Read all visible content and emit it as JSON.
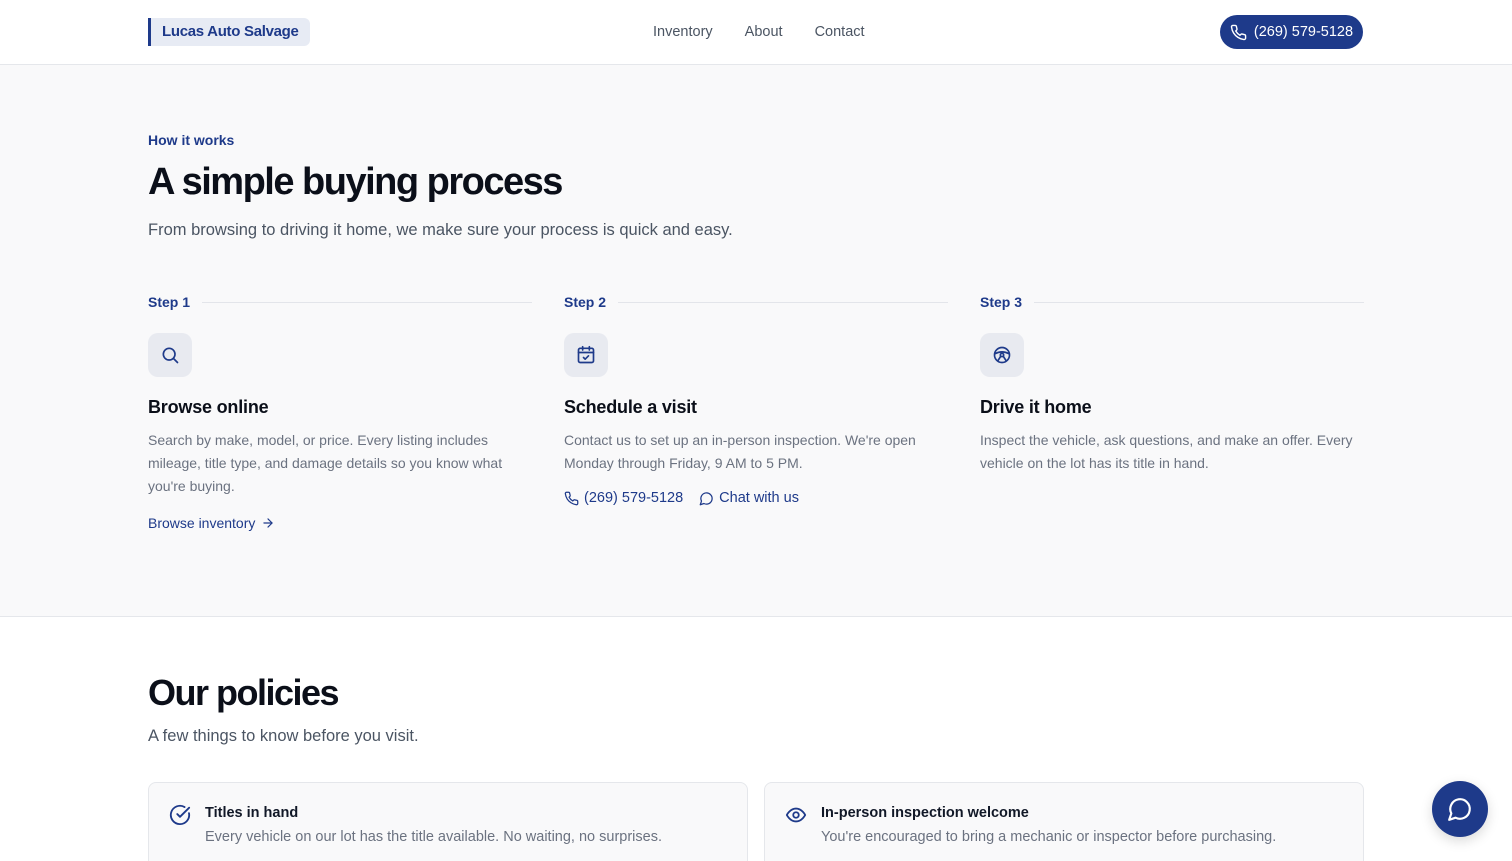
{
  "header": {
    "logo": "Lucas Auto Salvage",
    "nav": [
      "Inventory",
      "About",
      "Contact"
    ],
    "phone": "(269) 579-5128"
  },
  "how": {
    "eyebrow": "How it works",
    "title": "A simple buying process",
    "subtitle": "From browsing to driving it home, we make sure your process is quick and easy.",
    "steps": [
      {
        "label": "Step 1",
        "icon": "search-icon",
        "title": "Browse online",
        "desc": "Search by make, model, or price. Every listing includes mileage, title type, and damage details so you know what you're buying.",
        "link": "Browse inventory"
      },
      {
        "label": "Step 2",
        "icon": "calendar-check-icon",
        "title": "Schedule a visit",
        "desc": "Contact us to set up an in-person inspection. We're open Monday through Friday, 9 AM to 5 PM.",
        "phone": "(269) 579-5128",
        "chat": "Chat with us"
      },
      {
        "label": "Step 3",
        "icon": "steering-wheel-icon",
        "title": "Drive it home",
        "desc": "Inspect the vehicle, ask questions, and make an offer. Every vehicle on the lot has its title in hand."
      }
    ]
  },
  "policies": {
    "title": "Our policies",
    "subtitle": "A few things to know before you visit.",
    "items": [
      {
        "icon": "check-circle-icon",
        "title": "Titles in hand",
        "desc": "Every vehicle on our lot has the title available. No waiting, no surprises."
      },
      {
        "icon": "eye-icon",
        "title": "In-person inspection welcome",
        "desc": "You're encouraged to bring a mechanic or inspector before purchasing."
      }
    ]
  },
  "colors": {
    "brand": "#1e3a8a",
    "section_bg": "#f9f9fa",
    "muted_text": "#6b7280"
  }
}
